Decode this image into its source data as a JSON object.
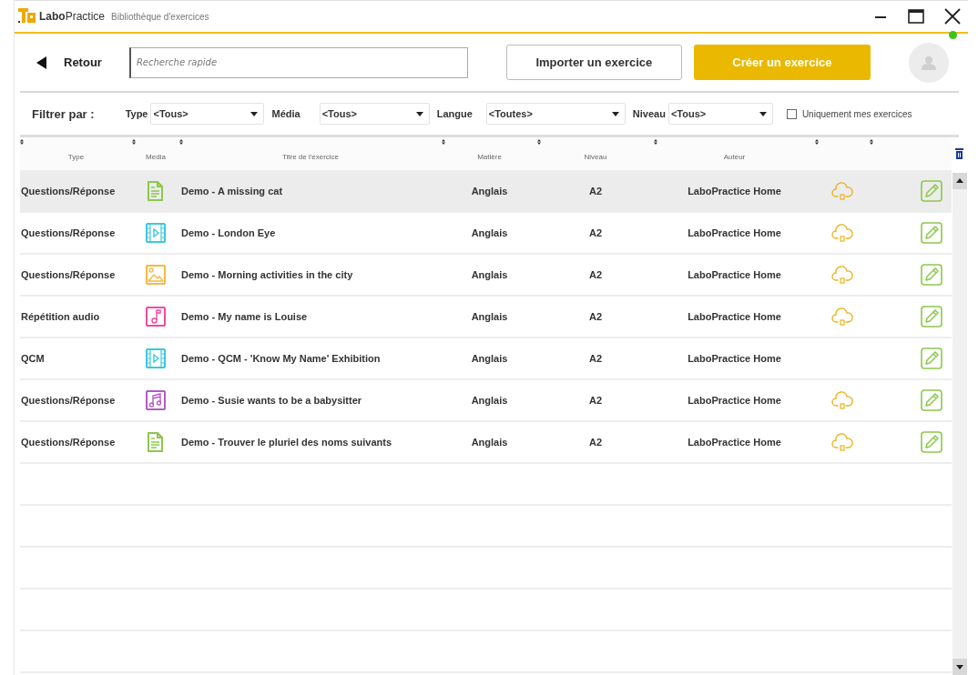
{
  "window": {
    "app_name": "**Labo**Practice",
    "title": "Bibliothèque d'exercices"
  },
  "toolbar": {
    "back_label": "Retour",
    "search": {
      "placeholder": "Recherche rapide"
    },
    "import_label": "Importer un exercice",
    "create_label": "Créer un exercice",
    "user_online": true
  },
  "filters": {
    "label": "Filtrer par :",
    "selects": [
      {
        "label": "Type",
        "value": "<Tous>"
      },
      {
        "label": "Média",
        "value": "<Tous>"
      },
      {
        "label": "Langue",
        "value": "<Toutes>"
      },
      {
        "label": "Niveau",
        "value": "<Tous>"
      }
    ],
    "only_mine": {
      "label": "Uniquement mes exercices",
      "checked": false
    }
  },
  "table": {
    "columns": [
      "Type",
      "Media",
      "Titre de l'exercice",
      "Matière",
      "Niveau",
      "Auteur"
    ],
    "rows": [
      {
        "type": "Questions/Réponse",
        "media": {
          "kind": "document",
          "color": "#8cc84b"
        },
        "title": "Demo - A missing cat",
        "subject": "Anglais",
        "level": "A2",
        "author": "LaboPractice Home",
        "cloud": true,
        "selected": true
      },
      {
        "type": "Questions/Réponse",
        "media": {
          "kind": "video",
          "color": "#3cc8dc"
        },
        "title": "Demo - London Eye",
        "subject": "Anglais",
        "level": "A2",
        "author": "LaboPractice Home",
        "cloud": true,
        "selected": false
      },
      {
        "type": "Questions/Réponse",
        "media": {
          "kind": "image",
          "color": "#f5b945"
        },
        "title": "Demo - Morning activities in the city",
        "subject": "Anglais",
        "level": "A2",
        "author": "LaboPractice Home",
        "cloud": true,
        "selected": false
      },
      {
        "type": "Répétition audio",
        "media": {
          "kind": "note",
          "color": "#f04ba0"
        },
        "title": "Demo - My name is Louise",
        "subject": "Anglais",
        "level": "A2",
        "author": "LaboPractice Home",
        "cloud": true,
        "selected": false
      },
      {
        "type": "QCM",
        "media": {
          "kind": "video",
          "color": "#3cc8dc"
        },
        "title": "Demo - QCM - 'Know My Name' Exhibition",
        "subject": "Anglais",
        "level": "A2",
        "author": "LaboPractice Home",
        "cloud": false,
        "selected": false
      },
      {
        "type": "Questions/Réponse",
        "media": {
          "kind": "music",
          "color": "#b45ac8"
        },
        "title": "Demo - Susie wants to be a babysitter",
        "subject": "Anglais",
        "level": "A2",
        "author": "LaboPractice Home",
        "cloud": true,
        "selected": false
      },
      {
        "type": "Questions/Réponse",
        "media": {
          "kind": "document",
          "color": "#8cc84b"
        },
        "title": "Demo - Trouver le pluriel des noms suivants",
        "subject": "Anglais",
        "level": "A2",
        "author": "LaboPractice Home",
        "cloud": true,
        "selected": false
      }
    ]
  }
}
